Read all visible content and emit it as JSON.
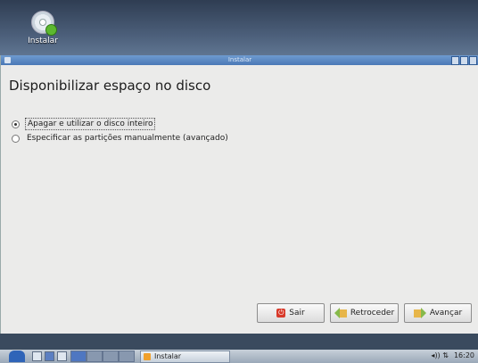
{
  "desktop": {
    "icon_label": "Instalar"
  },
  "window": {
    "title": "Instalar",
    "heading": "Disponibilizar espaço no disco",
    "options": [
      {
        "label": "Apagar e utilizar o disco inteiro",
        "selected": true
      },
      {
        "label": "Especificar as partições manualmente (avançado)",
        "selected": false
      }
    ],
    "buttons": {
      "quit": "Sair",
      "back": "Retroceder",
      "forward": "Avançar"
    }
  },
  "taskbar": {
    "task_label": "Instalar",
    "time": "16:20",
    "indicators": "◂)) ⇅"
  },
  "colors": {
    "titlebar": "#4a78b6",
    "accent": "#86b94a"
  }
}
